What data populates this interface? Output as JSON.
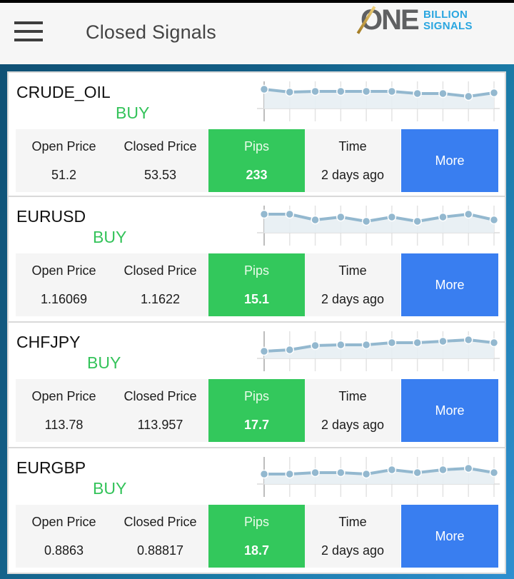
{
  "app": {
    "title": "Closed Signals",
    "logo": {
      "big": "ONE",
      "line1": "BILLION",
      "line2": "SIGNALS"
    }
  },
  "labels": {
    "open_price": "Open Price",
    "closed_price": "Closed Price",
    "pips": "Pips",
    "time": "Time",
    "more": "More"
  },
  "colors": {
    "buy": "#34c35a",
    "pips_bg": "#33c85c",
    "more_bg": "#397ef0",
    "spark_line": "#93b8cf",
    "spark_fill": "#e7eef3"
  },
  "signals": [
    {
      "symbol": "CRUDE_OIL",
      "side": "BUY",
      "open_price": "51.2",
      "closed_price": "53.53",
      "pips": "233",
      "time": "2 days ago",
      "sparkline": [
        25,
        21,
        22,
        22,
        22,
        22,
        19,
        19,
        15,
        20
      ]
    },
    {
      "symbol": "EURUSD",
      "side": "BUY",
      "open_price": "1.16069",
      "closed_price": "1.1622",
      "pips": "15.1",
      "time": "2 days ago",
      "sparkline": [
        24,
        24,
        16,
        20,
        14,
        20,
        14,
        20,
        24,
        16
      ]
    },
    {
      "symbol": "CHFJPY",
      "side": "BUY",
      "open_price": "113.78",
      "closed_price": "113.957",
      "pips": "17.7",
      "time": "2 days ago",
      "sparkline": [
        8,
        10,
        16,
        17,
        17,
        20,
        20,
        22,
        24,
        20
      ]
    },
    {
      "symbol": "EURGBP",
      "side": "BUY",
      "open_price": "0.8863",
      "closed_price": "0.88817",
      "pips": "18.7",
      "time": "2 days ago",
      "sparkline": [
        12,
        12,
        14,
        14,
        12,
        18,
        14,
        18,
        20,
        14
      ]
    }
  ]
}
